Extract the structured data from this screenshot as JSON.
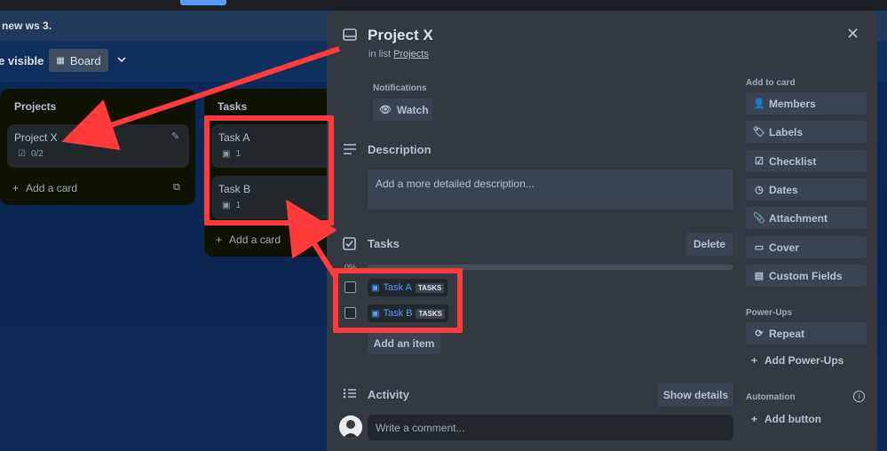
{
  "top": {
    "workspace": "new ws 3.",
    "visibility": "e visible",
    "view_label": "Board"
  },
  "lists": [
    {
      "title": "Projects",
      "cards": [
        {
          "title": "Project X",
          "checklist": "0/2"
        }
      ],
      "add_card": "Add a card"
    },
    {
      "title": "Tasks",
      "cards": [
        {
          "title": "Task A",
          "count": "1"
        },
        {
          "title": "Task B",
          "count": "1"
        }
      ],
      "add_card": "Add a card"
    }
  ],
  "modal": {
    "title": "Project X",
    "in_list_prefix": "in list",
    "in_list_name": "Projects",
    "notifications_label": "Notifications",
    "watch_label": "Watch",
    "description_title": "Description",
    "description_placeholder": "Add a more detailed description...",
    "checklist_title": "Tasks",
    "delete_label": "Delete",
    "progress_text": "0%",
    "progress_value": 0,
    "items": [
      {
        "name": "Task A",
        "tag": "TASKS"
      },
      {
        "name": "Task B",
        "tag": "TASKS"
      }
    ],
    "add_item": "Add an item",
    "activity_title": "Activity",
    "show_details": "Show details",
    "comment_placeholder": "Write a comment..."
  },
  "sidebar": {
    "add_to_card": "Add to card",
    "buttons": [
      "Members",
      "Labels",
      "Checklist",
      "Dates",
      "Attachment",
      "Cover",
      "Custom Fields"
    ],
    "powerups_label": "Power-Ups",
    "repeat": "Repeat",
    "add_powerups": "Add Power-Ups",
    "automation_label": "Automation",
    "add_button": "Add button"
  },
  "colors": {
    "annotation_red": "#ff3b3b",
    "link_blue": "#579dff",
    "modal_bg": "#323940"
  }
}
